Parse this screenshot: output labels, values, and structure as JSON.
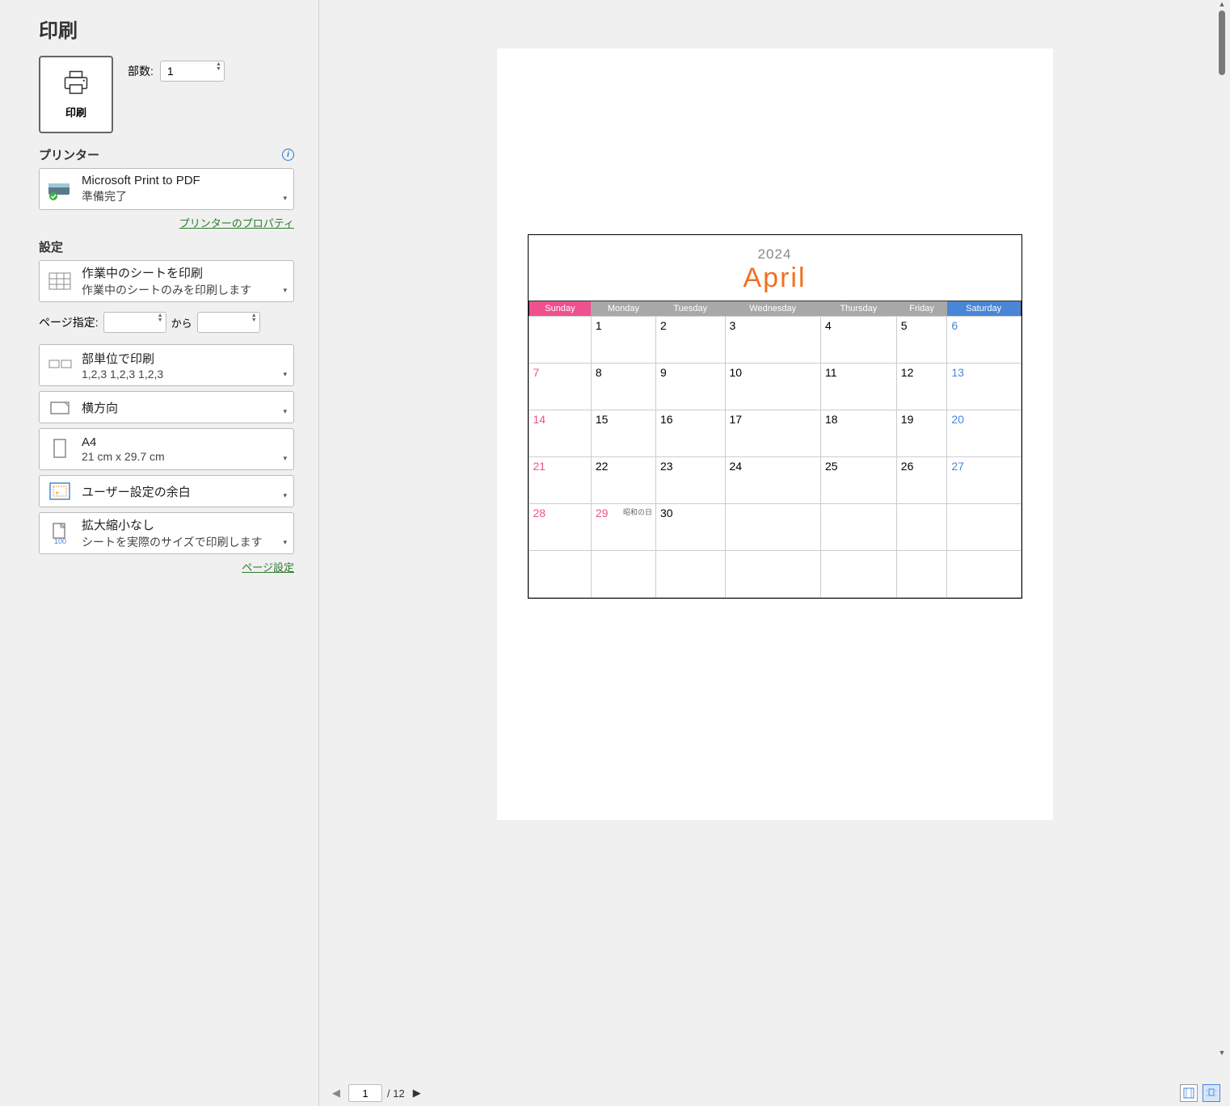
{
  "title": "印刷",
  "print_button_label": "印刷",
  "copies": {
    "label": "部数:",
    "value": "1"
  },
  "printer_section": "プリンター",
  "printer": {
    "name": "Microsoft Print to PDF",
    "status": "準備完了"
  },
  "printer_props_link": "プリンターのプロパティ",
  "settings_section": "設定",
  "print_what": {
    "t1": "作業中のシートを印刷",
    "t2": "作業中のシートのみを印刷します"
  },
  "page_range": {
    "label": "ページ指定:",
    "from": "",
    "to_word": "から",
    "to": ""
  },
  "collate": {
    "t1": "部単位で印刷",
    "t2": "1,2,3    1,2,3    1,2,3"
  },
  "orientation": {
    "t1": "横方向"
  },
  "paper": {
    "t1": "A4",
    "t2": "21 cm x 29.7 cm"
  },
  "margins": {
    "t1": "ユーザー設定の余白"
  },
  "scaling": {
    "t1": "拡大縮小なし",
    "t2": "シートを実際のサイズで印刷します"
  },
  "page_setup_link": "ページ設定",
  "nav": {
    "current": "1",
    "total": "12",
    "sep": "/"
  },
  "calendar": {
    "year": "2024",
    "month": "April",
    "dow": [
      "Sunday",
      "Monday",
      "Tuesday",
      "Wednesday",
      "Thursday",
      "Friday",
      "Saturday"
    ],
    "rows": [
      [
        {
          "n": ""
        },
        {
          "n": "1"
        },
        {
          "n": "2"
        },
        {
          "n": "3"
        },
        {
          "n": "4"
        },
        {
          "n": "5"
        },
        {
          "n": "6"
        }
      ],
      [
        {
          "n": "7"
        },
        {
          "n": "8"
        },
        {
          "n": "9"
        },
        {
          "n": "10"
        },
        {
          "n": "11"
        },
        {
          "n": "12"
        },
        {
          "n": "13"
        }
      ],
      [
        {
          "n": "14"
        },
        {
          "n": "15"
        },
        {
          "n": "16"
        },
        {
          "n": "17"
        },
        {
          "n": "18"
        },
        {
          "n": "19"
        },
        {
          "n": "20"
        }
      ],
      [
        {
          "n": "21"
        },
        {
          "n": "22"
        },
        {
          "n": "23"
        },
        {
          "n": "24"
        },
        {
          "n": "25"
        },
        {
          "n": "26"
        },
        {
          "n": "27"
        }
      ],
      [
        {
          "n": "28"
        },
        {
          "n": "29",
          "hol": "昭和の日"
        },
        {
          "n": "30"
        },
        {
          "n": ""
        },
        {
          "n": ""
        },
        {
          "n": ""
        },
        {
          "n": ""
        }
      ],
      [
        {
          "n": ""
        },
        {
          "n": ""
        },
        {
          "n": ""
        },
        {
          "n": ""
        },
        {
          "n": ""
        },
        {
          "n": ""
        },
        {
          "n": ""
        }
      ]
    ]
  }
}
